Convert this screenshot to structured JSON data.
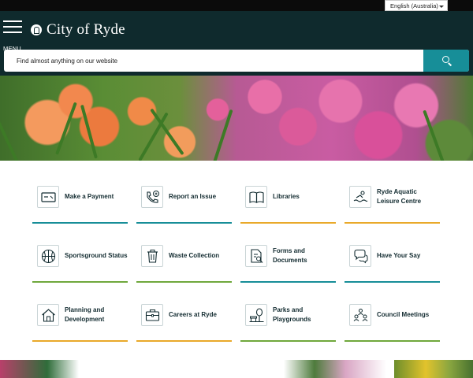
{
  "language_select": {
    "value": "English (Australia)"
  },
  "header": {
    "menu_label": "MENU",
    "logo_text": "City of Ryde",
    "brand_color": "#0f2a2d",
    "accent_color": "#178e98"
  },
  "search": {
    "placeholder": "Find almost anything on our website",
    "button_icon": "search-icon"
  },
  "hero": {
    "description_icon": "flower-garden-banner"
  },
  "quick_links": [
    {
      "label": "Make a Payment",
      "icon": "payment-card-icon",
      "underline_color": "#178e98"
    },
    {
      "label": "Report an Issue",
      "icon": "report-phone-icon",
      "underline_color": "#178e98"
    },
    {
      "label": "Libraries",
      "icon": "open-book-icon",
      "underline_color": "#e9a92a"
    },
    {
      "label": "Ryde Aquatic Leisure Centre",
      "icon": "swimmer-icon",
      "underline_color": "#e9a92a"
    },
    {
      "label": "Sportsground Status",
      "icon": "basketball-icon",
      "underline_color": "#6fa83c"
    },
    {
      "label": "Waste Collection",
      "icon": "bin-icon",
      "underline_color": "#6fa83c"
    },
    {
      "label": "Forms and Documents",
      "icon": "document-search-icon",
      "underline_color": "#178e98"
    },
    {
      "label": "Have Your Say",
      "icon": "speech-bubbles-icon",
      "underline_color": "#178e98"
    },
    {
      "label": "Planning and Development",
      "icon": "house-icon",
      "underline_color": "#e9a92a"
    },
    {
      "label": "Careers at Ryde",
      "icon": "briefcase-icon",
      "underline_color": "#e9a92a"
    },
    {
      "label": "Parks and Playgrounds",
      "icon": "park-tree-icon",
      "underline_color": "#6fa83c"
    },
    {
      "label": "Council Meetings",
      "icon": "people-meeting-icon",
      "underline_color": "#6fa83c"
    }
  ]
}
